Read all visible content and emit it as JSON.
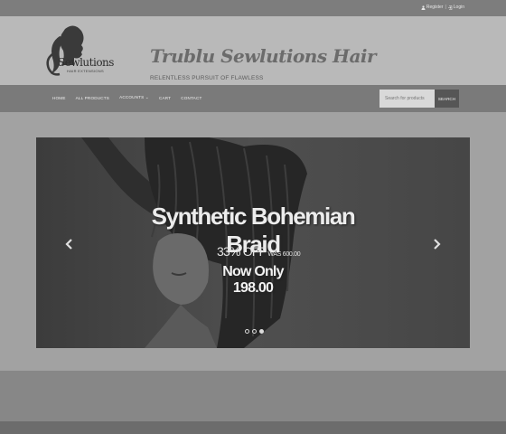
{
  "topbar": {
    "register_label": "Register",
    "separator": "|",
    "login_label": "Login"
  },
  "header": {
    "logo_text": "Sewlutions",
    "logo_subtext": "HAIR EXTENSIONS",
    "site_title": "Trublu Sewlutions Hair",
    "tagline": "RELENTLESS PURSUIT OF FLAWLESS"
  },
  "nav": {
    "items": [
      {
        "label": "HOME"
      },
      {
        "label": "ALL PRODUCTS"
      },
      {
        "label": "ACCOUNTS ⌄"
      },
      {
        "label": "CART"
      },
      {
        "label": "CONTACT"
      }
    ],
    "search_placeholder": "Search for products",
    "search_button": "SEARCH"
  },
  "slider": {
    "title": "Synthetic Bohemian Braid",
    "discount": "33% OFF",
    "was_price": "WAS 600.00",
    "now_price": "Now Only 198.00",
    "prev_icon": "chevron-left-icon",
    "next_icon": "chevron-right-icon",
    "slide_count": 3,
    "active_slide": 3
  }
}
